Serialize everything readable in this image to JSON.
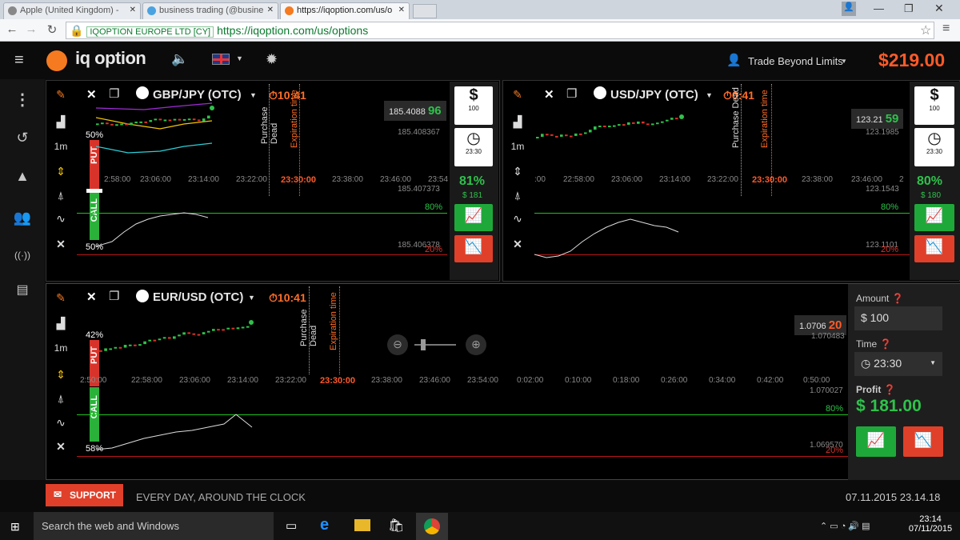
{
  "browser": {
    "tabs": [
      {
        "title": "Apple (United Kingdom) -"
      },
      {
        "title": "business trading (@busine"
      },
      {
        "title": "https://iqoption.com/us/o"
      }
    ],
    "ev_label": "IQOPTION EUROPE LTD [CY]",
    "url": "https://iqoption.com/us/options"
  },
  "header": {
    "logo_text": "iq option",
    "username": "Trade Beyond Limits",
    "balance": "$219.00"
  },
  "panels": {
    "p1": {
      "pair": "GBP/JPY (OTC)",
      "timer": "10:41",
      "timeframe": "1m",
      "price": "185.4088",
      "price_big": "96",
      "price2": "185.408367",
      "price3": "185.407373",
      "price4": "185.406378",
      "pct_top": "50%",
      "pct_bottom": "50%",
      "green_pct": "80%",
      "red_pct": "20%",
      "amount_btn": "100",
      "time_btn": "23:30",
      "payout": "81%",
      "profit_small": "$ 181",
      "purchase": "Purchase Dead",
      "expiration": "Expiration time",
      "expiry_axis": "23:30:00",
      "axis": [
        "2:58:00",
        "23:06:00",
        "23:14:00",
        "23:22:00",
        "23:38:00",
        "23:46:00",
        "23:54"
      ]
    },
    "p2": {
      "pair": "USD/JPY (OTC)",
      "timer": "0:41",
      "timeframe": "1m",
      "price": "123.21",
      "price_big": "59",
      "price2": "123.1985",
      "price3": "123.1543",
      "price4": "123.1101",
      "green_pct": "80%",
      "red_pct": "20%",
      "amount_btn": "100",
      "time_btn": "23:30",
      "payout": "80%",
      "profit_small": "$ 180",
      "purchase": "Purchase Dead",
      "expiration": "Expiration time",
      "expiry_axis": "23:30:00",
      "axis": [
        ":00",
        "22:58:00",
        "23:06:00",
        "23:14:00",
        "23:22:00",
        "23:38:00",
        "23:46:00",
        "2"
      ]
    },
    "p3": {
      "pair": "EUR/USD (OTC)",
      "timer": "10:41",
      "timeframe": "1m",
      "price": "1.0706",
      "price_big": "20",
      "price2": "1.070483",
      "price3": "1.070027",
      "price4": "1.069570",
      "pct_top": "42%",
      "pct_bottom": "58%",
      "green_pct": "80%",
      "red_pct": "20%",
      "purchase": "Purchase Dead",
      "expiration": "Expiration time",
      "expiry_axis": "23:30:00",
      "axis": [
        "2:50:00",
        "22:58:00",
        "23:06:00",
        "23:14:00",
        "23:22:00",
        "23:38:00",
        "23:46:00",
        "23:54:00",
        "0:02:00",
        "0:10:00",
        "0:18:00",
        "0:26:00",
        "0:34:00",
        "0:42:00",
        "0:50:00"
      ]
    }
  },
  "trade": {
    "amount_label": "Amount",
    "amount_value": "$ 100",
    "time_label": "Time",
    "time_value": "23:30",
    "profit_label": "Profit",
    "profit_value": "$ 181.00"
  },
  "footer": {
    "support": "SUPPORT",
    "tagline": "EVERY DAY, AROUND THE CLOCK",
    "datetime": "07.11.2015 23.14.18"
  },
  "taskbar": {
    "search_placeholder": "Search the web and Windows",
    "time": "23:14",
    "date": "07/11/2015"
  },
  "colors": {
    "accent": "#ff5a29",
    "green": "#1fa83a",
    "red": "#e0402a",
    "logo": "#f57a20"
  }
}
